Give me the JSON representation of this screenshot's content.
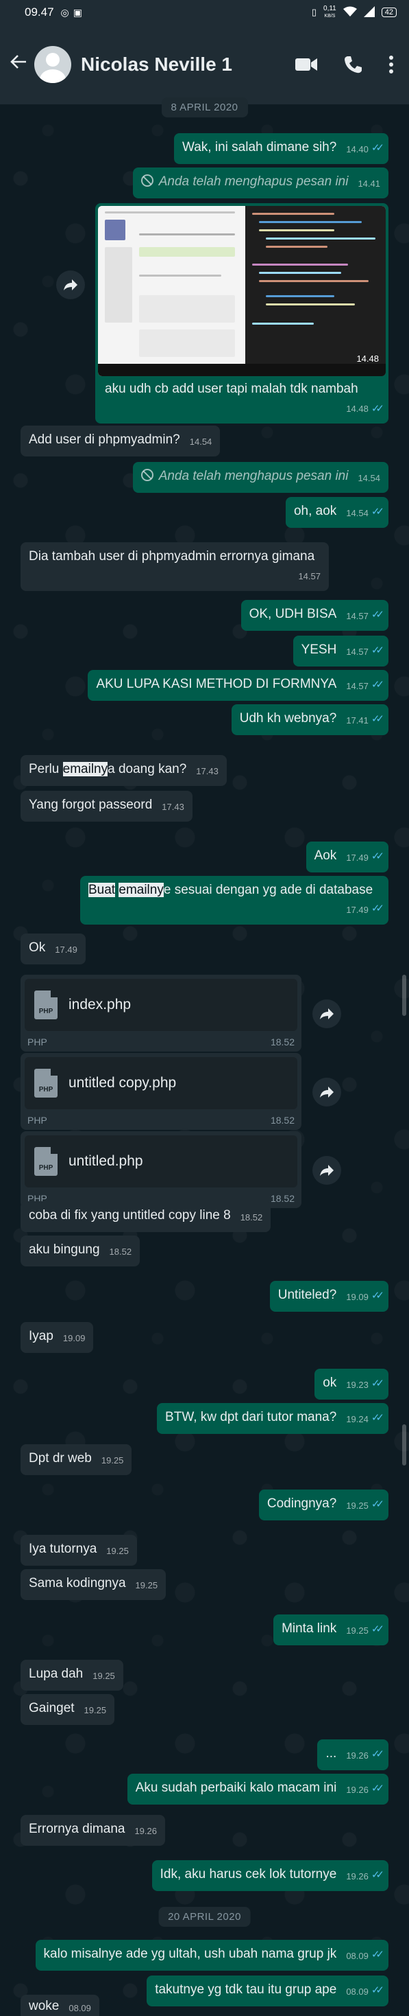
{
  "status_bar": {
    "time": "09.47",
    "net_speed": "0,11",
    "net_unit": "KB/S",
    "battery": "42"
  },
  "header": {
    "contact_name": "Nicolas Neville 1",
    "icons": [
      "back-arrow-icon",
      "avatar",
      "video-call-icon",
      "voice-call-icon",
      "more-options-icon"
    ]
  },
  "dates": [
    "8 APRIL 2020",
    "20 APRIL 2020"
  ],
  "image_message": {
    "stamp": "14.48",
    "caption": "aku udh cb add user tapi malah tdk nambah",
    "time": "14.48"
  },
  "messages": [
    {
      "dir": "out",
      "text": "Wak, ini salah dimane sih?",
      "time": "14.40",
      "ticks": true
    },
    {
      "dir": "out",
      "text": "Anda telah menghapus pesan ini",
      "time": "14.41",
      "deleted": true
    },
    {
      "dir": "in",
      "text": "Add user di phpmyadmin?",
      "time": "14.54"
    },
    {
      "dir": "out",
      "text": "Anda telah menghapus pesan ini",
      "time": "14.54",
      "deleted": true
    },
    {
      "dir": "out",
      "text": "oh, aok",
      "time": "14.54",
      "ticks": true
    },
    {
      "dir": "in",
      "text": "Dia tambah user di phpmyadmin errornya gimana",
      "time": "14.57"
    },
    {
      "dir": "out",
      "text": "OK, UDH BISA",
      "time": "14.57",
      "ticks": true
    },
    {
      "dir": "out",
      "text": "YESH",
      "time": "14.57",
      "ticks": true
    },
    {
      "dir": "out",
      "text": "AKU LUPA KASI METHOD DI FORMNYA",
      "time": "14.57",
      "ticks": true
    },
    {
      "dir": "out",
      "text": "Udh kh webnya?",
      "time": "17.41",
      "ticks": true
    },
    {
      "dir": "in",
      "text_a": "Perlu ",
      "text_hl": "emailny",
      "text_b": "a doang kan?",
      "time": "17.43"
    },
    {
      "dir": "in",
      "text": "Yang forgot passeord",
      "time": "17.43"
    },
    {
      "dir": "out",
      "text": "Aok",
      "time": "17.49",
      "ticks": true
    },
    {
      "dir": "out",
      "text_hl1": "Buat",
      "text_a": " ",
      "text_hl2": "emailny",
      "text_b": "e sesuai dengan yg ade di database",
      "time": "17.49",
      "ticks": true
    },
    {
      "dir": "in",
      "text": "Ok",
      "time": "17.49"
    }
  ],
  "files": [
    {
      "name": "index.php",
      "type": "PHP",
      "time": "18.52",
      "icon_label": "PHP"
    },
    {
      "name": "untitled copy.php",
      "type": "PHP",
      "time": "18.52",
      "icon_label": "PHP"
    },
    {
      "name": "untitled.php",
      "type": "PHP",
      "time": "18.52",
      "icon_label": "PHP"
    }
  ],
  "messages2": [
    {
      "dir": "in",
      "text": "coba di fix yang untitled copy line 8",
      "time": "18.52"
    },
    {
      "dir": "in",
      "text": "aku bingung",
      "time": "18.52"
    },
    {
      "dir": "out",
      "text": "Untiteled?",
      "time": "19.09",
      "ticks": true
    },
    {
      "dir": "in",
      "text": "Iyap",
      "time": "19.09"
    },
    {
      "dir": "out",
      "text": "ok",
      "time": "19.23",
      "ticks": true
    },
    {
      "dir": "out",
      "text": "BTW, kw dpt dari tutor mana?",
      "time": "19.24",
      "ticks": true
    },
    {
      "dir": "in",
      "text": "Dpt dr web",
      "time": "19.25"
    },
    {
      "dir": "out",
      "text": "Codingnya?",
      "time": "19.25",
      "ticks": true
    },
    {
      "dir": "in",
      "text": "Iya tutornya",
      "time": "19.25"
    },
    {
      "dir": "in",
      "text": "Sama kodingnya",
      "time": "19.25"
    },
    {
      "dir": "out",
      "text": "Minta link",
      "time": "19.25",
      "ticks": true
    },
    {
      "dir": "in",
      "text": "Lupa dah",
      "time": "19.25"
    },
    {
      "dir": "in",
      "text": "Gainget",
      "time": "19.25"
    },
    {
      "dir": "out",
      "text": "...",
      "time": "19.26",
      "ticks": true
    },
    {
      "dir": "out",
      "text": "Aku sudah perbaiki kalo macam ini",
      "time": "19.26",
      "ticks": true
    },
    {
      "dir": "in",
      "text": "Errornya dimana",
      "time": "19.26"
    },
    {
      "dir": "out",
      "text": "Idk, aku harus cek lok tutornye",
      "time": "19.26",
      "ticks": true
    },
    {
      "dir": "out",
      "text": "kalo misalnye ade yg ultah, ush ubah nama grup jk",
      "time": "08.09",
      "ticks": true
    },
    {
      "dir": "out",
      "text": "takutnye yg tdk tau itu grup ape",
      "time": "08.09",
      "ticks": true
    },
    {
      "dir": "in",
      "text": "woke",
      "time": "08.09"
    }
  ]
}
